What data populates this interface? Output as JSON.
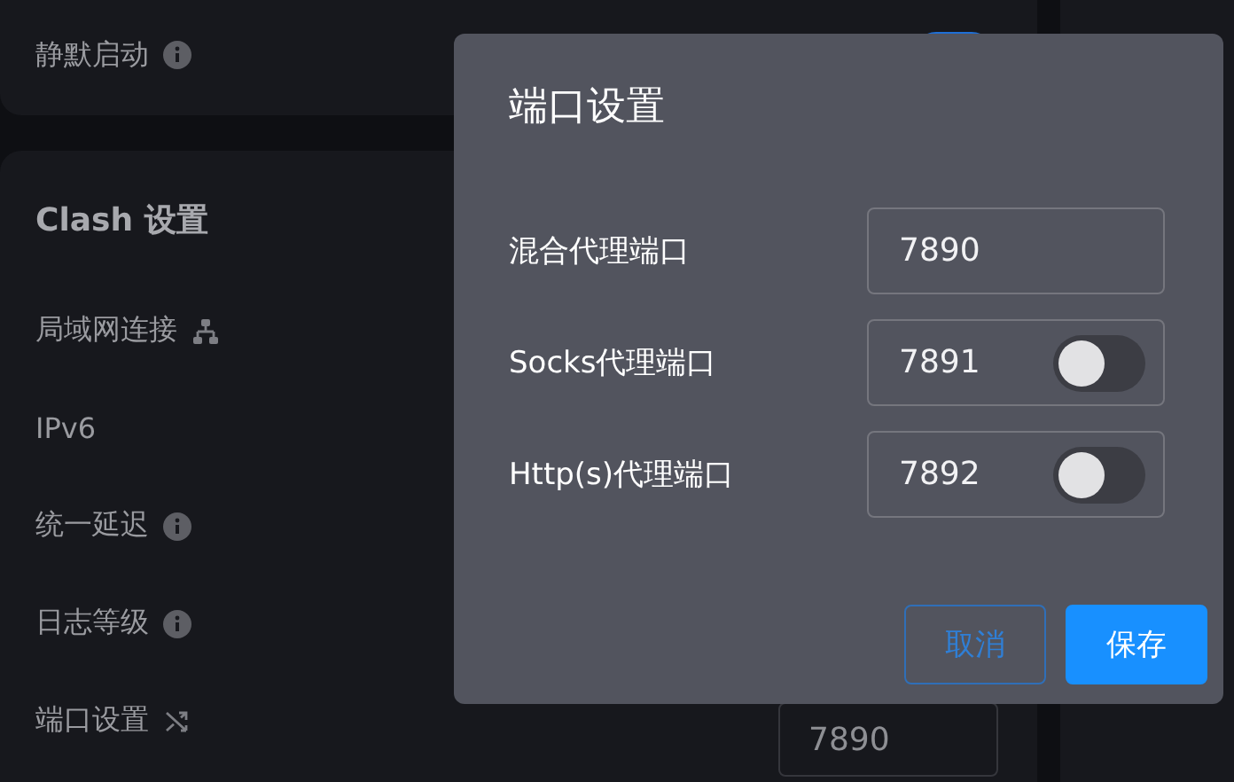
{
  "startup_card": {
    "rows": [
      {
        "label": "静默启动",
        "kind": "info",
        "toggle": {
          "on": true
        }
      }
    ]
  },
  "clash_card": {
    "title": "Clash 设置",
    "rows": [
      {
        "label": "局域网连接",
        "kind": "network"
      },
      {
        "label": "IPv6",
        "kind": "plain"
      },
      {
        "label": "统一延迟",
        "kind": "info"
      },
      {
        "label": "日志等级",
        "kind": "info"
      },
      {
        "label": "端口设置",
        "kind": "shuffle",
        "value": "7890"
      }
    ]
  },
  "dialog": {
    "title": "端口设置",
    "fields": [
      {
        "label": "混合代理端口",
        "value": "7890"
      },
      {
        "label": "Socks代理端口",
        "value": "7891",
        "toggle": {
          "on": false
        }
      },
      {
        "label": "Http(s)代理端口",
        "value": "7892",
        "toggle": {
          "on": false
        }
      }
    ],
    "buttons": [
      {
        "label": "取消",
        "kind": "secondary"
      },
      {
        "label": "保存",
        "kind": "primary"
      }
    ]
  }
}
